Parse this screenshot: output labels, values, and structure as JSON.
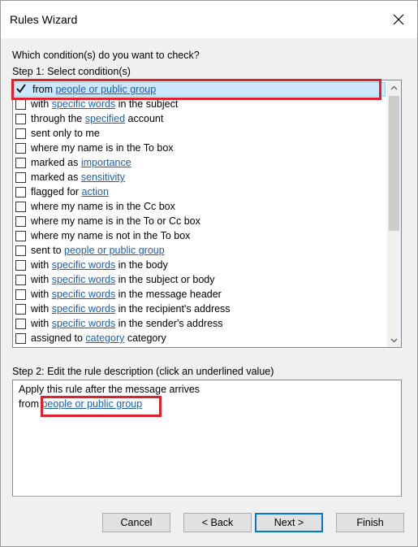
{
  "window": {
    "title": "Rules Wizard",
    "close_icon": "close-icon"
  },
  "prompt": "Which condition(s) do you want to check?",
  "step1_label": "Step 1: Select condition(s)",
  "conditions": [
    {
      "checked": true,
      "pre": "from ",
      "link": "people or public group",
      "post": ""
    },
    {
      "checked": false,
      "pre": "with ",
      "link": "specific words",
      "post": " in the subject"
    },
    {
      "checked": false,
      "pre": "through the ",
      "link": "specified",
      "post": " account"
    },
    {
      "checked": false,
      "pre": "sent only to me",
      "link": "",
      "post": ""
    },
    {
      "checked": false,
      "pre": "where my name is in the To box",
      "link": "",
      "post": ""
    },
    {
      "checked": false,
      "pre": "marked as ",
      "link": "importance",
      "post": ""
    },
    {
      "checked": false,
      "pre": "marked as ",
      "link": "sensitivity",
      "post": ""
    },
    {
      "checked": false,
      "pre": "flagged for ",
      "link": "action",
      "post": ""
    },
    {
      "checked": false,
      "pre": "where my name is in the Cc box",
      "link": "",
      "post": ""
    },
    {
      "checked": false,
      "pre": "where my name is in the To or Cc box",
      "link": "",
      "post": ""
    },
    {
      "checked": false,
      "pre": "where my name is not in the To box",
      "link": "",
      "post": ""
    },
    {
      "checked": false,
      "pre": "sent to ",
      "link": "people or public group",
      "post": ""
    },
    {
      "checked": false,
      "pre": "with ",
      "link": "specific words",
      "post": " in the body"
    },
    {
      "checked": false,
      "pre": "with ",
      "link": "specific words",
      "post": " in the subject or body"
    },
    {
      "checked": false,
      "pre": "with ",
      "link": "specific words",
      "post": " in the message header"
    },
    {
      "checked": false,
      "pre": "with ",
      "link": "specific words",
      "post": " in the recipient's address"
    },
    {
      "checked": false,
      "pre": "with ",
      "link": "specific words",
      "post": " in the sender's address"
    },
    {
      "checked": false,
      "pre": "assigned to ",
      "link": "category",
      "post": " category"
    }
  ],
  "step2_label": "Step 2: Edit the rule description (click an underlined value)",
  "description": {
    "line1": "Apply this rule after the message arrives",
    "line2_pre": "from ",
    "line2_link": "people or public group"
  },
  "buttons": {
    "cancel": "Cancel",
    "back": "< Back",
    "next": "Next >",
    "finish": "Finish"
  },
  "colors": {
    "link": "#1a5fb4",
    "highlight": "#e0202a",
    "selection": "#cce8ff"
  }
}
